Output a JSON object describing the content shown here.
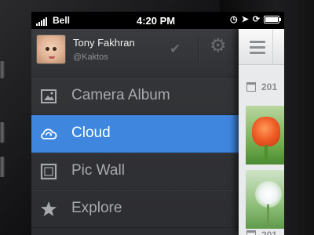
{
  "status_bar": {
    "carrier": "Bell",
    "time": "4:20 PM"
  },
  "profile": {
    "name": "Tony Fakhran",
    "handle": "@Kaktos"
  },
  "menu": {
    "items": [
      {
        "label": "Camera Album",
        "icon": "camera-album-icon",
        "active": false
      },
      {
        "label": "Cloud",
        "icon": "cloud-sync-icon",
        "active": true
      },
      {
        "label": "Pic Wall",
        "icon": "picture-frame-icon",
        "active": false
      },
      {
        "label": "Explore",
        "icon": "star-explore-icon",
        "active": false
      }
    ]
  },
  "content": {
    "date_rows": [
      "201",
      "201"
    ]
  },
  "colors": {
    "accent": "#3f86de",
    "drawer_bg": "#2f3033",
    "content_bg": "#e9eaec"
  }
}
